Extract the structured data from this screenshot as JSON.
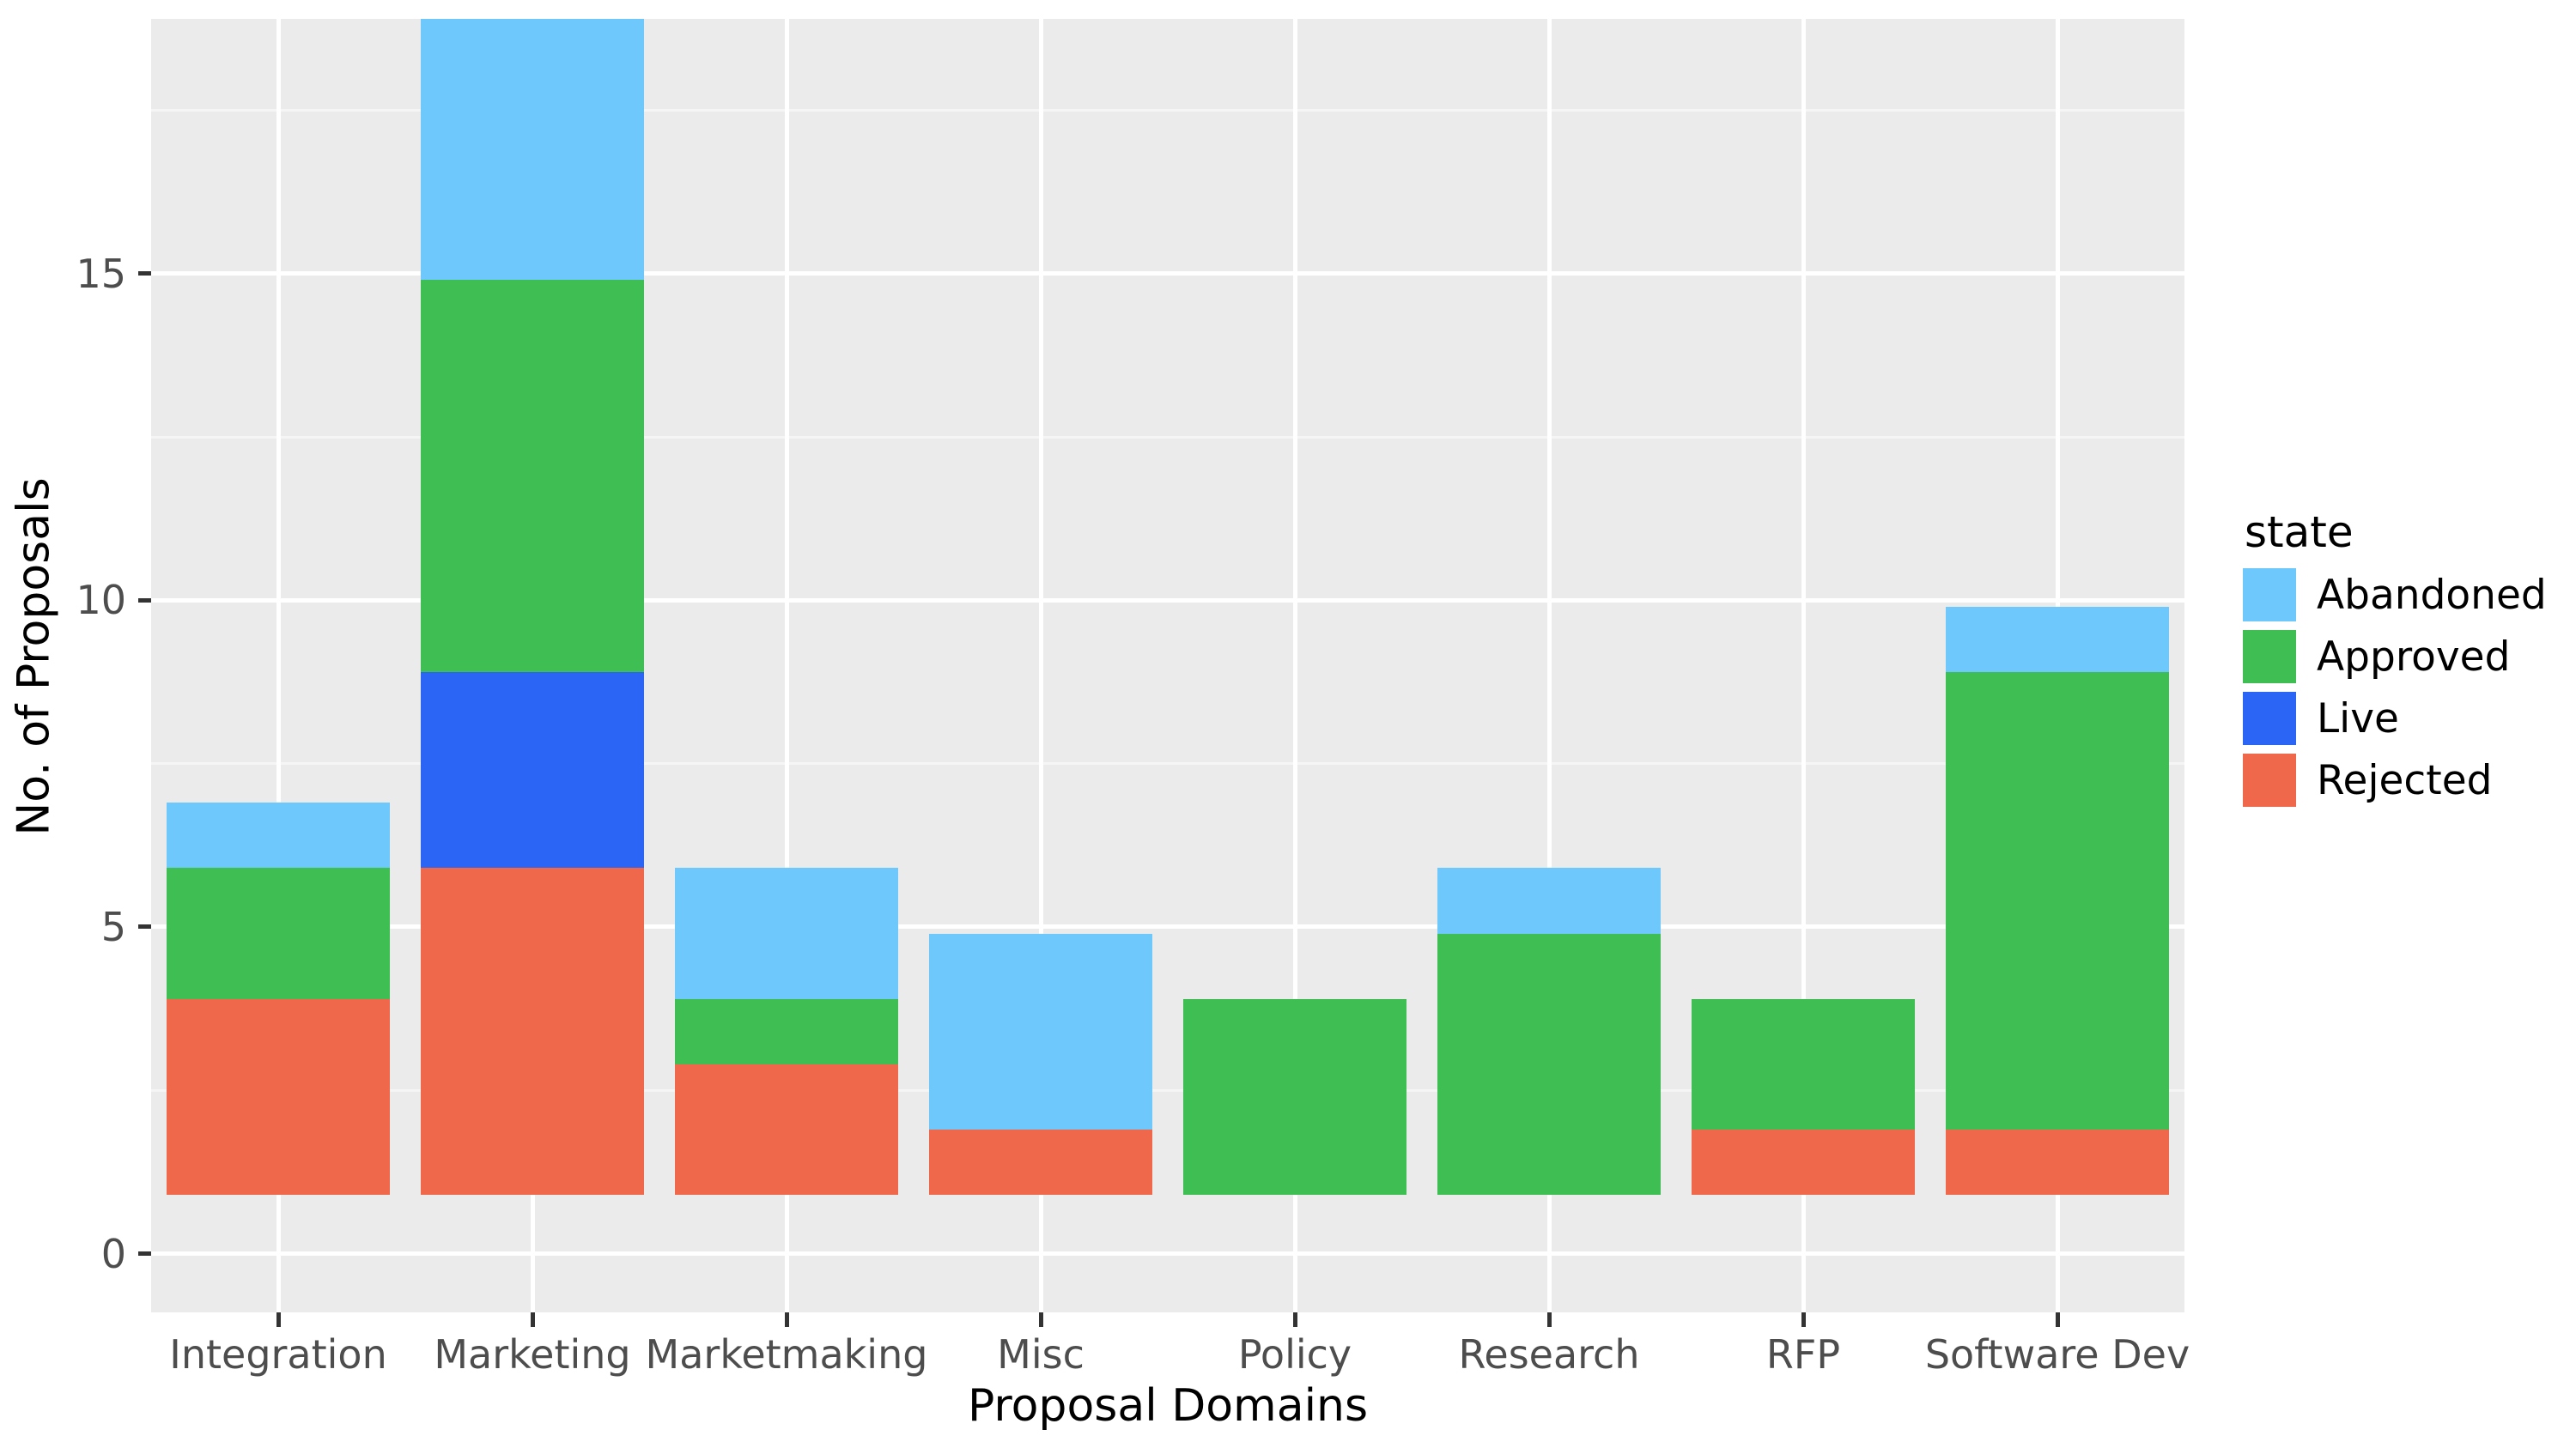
{
  "chart_data": {
    "type": "bar",
    "stacked": true,
    "title": "",
    "subtitle": "",
    "xlabel": "Proposal Domains",
    "ylabel": "No. of Proposals",
    "categories": [
      "Integration",
      "Marketing",
      "Marketmaking",
      "Misc",
      "Policy",
      "Research",
      "RFP",
      "Software Dev"
    ],
    "series": [
      {
        "name": "Rejected",
        "color": "#F0684C",
        "values": [
          3,
          5,
          2,
          1,
          0,
          0,
          1,
          1
        ]
      },
      {
        "name": "Live",
        "color": "#2B65F5",
        "values": [
          0,
          3,
          0,
          0,
          0,
          0,
          0,
          0
        ]
      },
      {
        "name": "Approved",
        "color": "#3FBF53",
        "values": [
          2,
          6,
          1,
          0,
          3,
          4,
          2,
          7
        ]
      },
      {
        "name": "Abandoned",
        "color": "#6EC8FC",
        "values": [
          1,
          4,
          2,
          3,
          0,
          1,
          0,
          1
        ]
      }
    ],
    "stack_order_bottom_to_top": [
      "Rejected",
      "Live",
      "Approved",
      "Abandoned"
    ],
    "totals": [
      6,
      18,
      5,
      4,
      3,
      5,
      3,
      9
    ],
    "ylim": [
      -0.9,
      18.9
    ],
    "y_major_ticks": [
      0,
      5,
      10,
      15
    ],
    "y_tick_labels": [
      "0",
      "5",
      "10",
      "15"
    ],
    "y_minor_ticks": [
      2.5,
      7.5,
      12.5,
      17.5
    ],
    "grid": true,
    "legend_position": "right"
  },
  "legend": {
    "title": "state",
    "items": [
      {
        "label": "Abandoned",
        "color": "#6EC8FC"
      },
      {
        "label": "Approved",
        "color": "#3FBF53"
      },
      {
        "label": "Live",
        "color": "#2B65F5"
      },
      {
        "label": "Rejected",
        "color": "#F0684C"
      }
    ]
  },
  "theme": {
    "panel_background": "#EBEBEB",
    "grid_major_color": "#FFFFFF",
    "grid_minor_color": "#F5F5F5",
    "axis_text_color": "#4D4D4D",
    "axis_title_color": "#000000",
    "plot_background": "#FFFFFF"
  }
}
